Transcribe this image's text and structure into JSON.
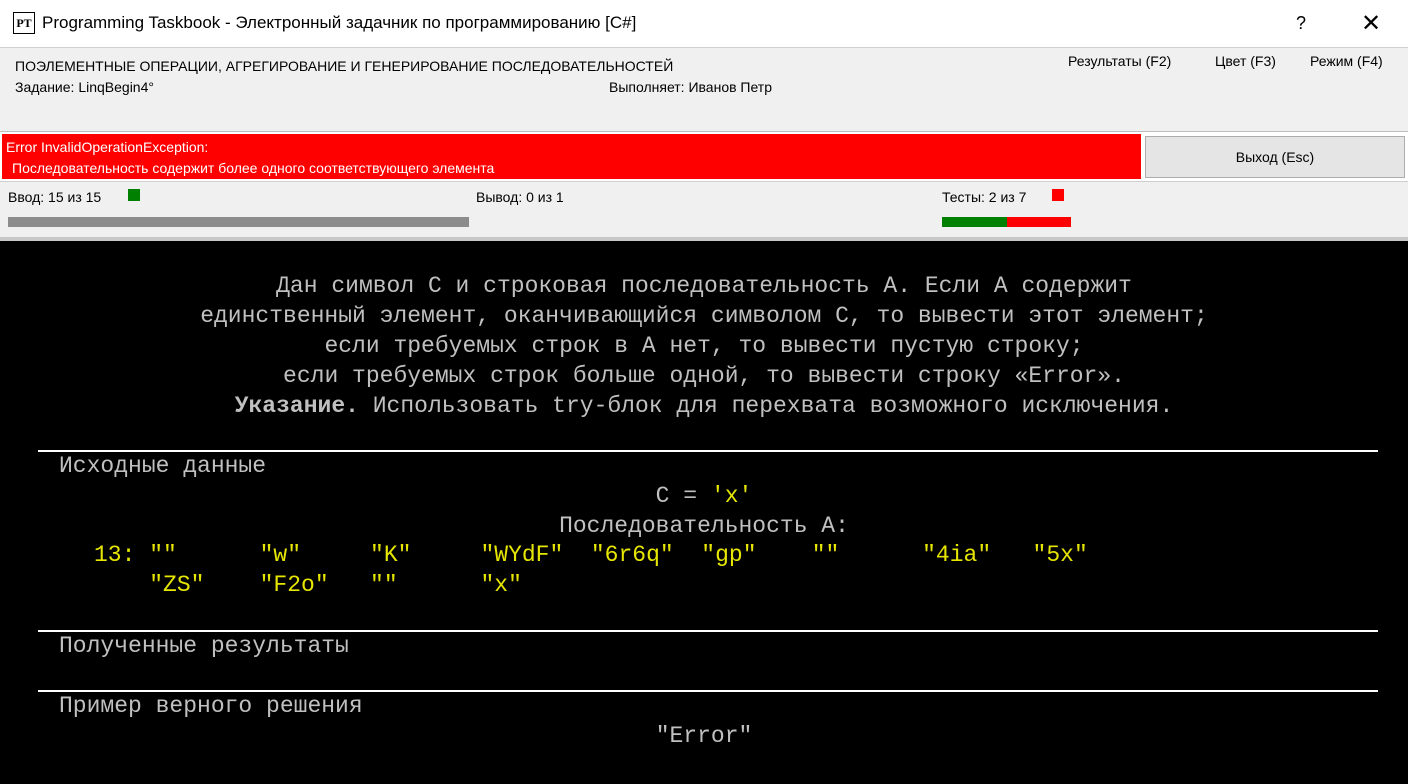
{
  "window": {
    "icon_text": "PT",
    "title": "Programming Taskbook - Электронный задачник по программированию [C#]",
    "help": "?",
    "close": "✕"
  },
  "header": {
    "title": "ПОЭЛЕМЕНТНЫЕ ОПЕРАЦИИ, АГРЕГИРОВАНИЕ И ГЕНЕРИРОВАНИЕ ПОСЛЕДОВАТЕЛЬНОСТЕЙ",
    "task": "Задание: LinqBegin4°",
    "performer": "Выполняет: Иванов Петр",
    "menu": {
      "results": "Результаты (F2)",
      "color": "Цвет (F3)",
      "mode": "Режим (F4)"
    }
  },
  "error": {
    "line1": "Error InvalidOperationException:",
    "line2": "Последовательность содержит более одного соответствующего элемента",
    "color": "#ff0000"
  },
  "exit_button": "Выход (Esc)",
  "status": {
    "input": "Ввод:  15 из 15",
    "input_progress": 1.0,
    "output": "Вывод:  0 из 1",
    "tests": "Тесты:  2 из 7",
    "tests_passed_fraction": 0.5,
    "green": "#008000",
    "red": "#ff0000"
  },
  "description": {
    "line1": "Дан символ C и строковая последовательность A. Если A содержит",
    "line2": "единственный элемент, оканчивающийся символом C, то вывести этот элемент;",
    "line3": "если требуемых строк в A нет, то вывести пустую строку;",
    "line4": "если требуемых строк больше одной, то вывести строку «Error».",
    "hint_bold": "Указание.",
    "hint_rest": " Использовать try-блок для перехвата возможного исключения."
  },
  "sections": {
    "input": "Исходные данные",
    "results": "Полученные результаты",
    "example": "Пример верного решения"
  },
  "input_data": {
    "c_line": "C = 'x'",
    "seq_title": "Последовательность A:",
    "row1": "13: \"\"      \"w\"     \"K\"     \"WYdF\"  \"6r6q\"  \"gp\"    \"\"      \"4ia\"   \"5x\"",
    "row2": "    \"ZS\"    \"F2o\"   \"\"      \"x\""
  },
  "example_output": "\"Error\""
}
